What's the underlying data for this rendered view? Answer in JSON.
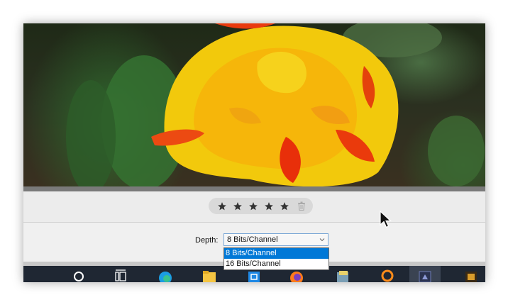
{
  "rating": {
    "stars": [
      {
        "icon": "star-icon"
      },
      {
        "icon": "star-icon"
      },
      {
        "icon": "star-icon"
      },
      {
        "icon": "star-icon"
      },
      {
        "icon": "star-icon"
      }
    ],
    "delete_icon": "trash-icon"
  },
  "depth": {
    "label": "Depth:",
    "selected": "8 Bits/Channel",
    "options": [
      "8 Bits/Channel",
      "16 Bits/Channel"
    ]
  },
  "taskbar": {
    "icons": [
      "search-icon",
      "task-view-icon",
      "edge-icon",
      "file-explorer-icon",
      "store-icon",
      "firefox-icon",
      "app-icon",
      "app-icon",
      "app-icon",
      "app-icon"
    ]
  },
  "colors": {
    "accent": "#0078d7",
    "taskbar": "#1f2733",
    "toolbar": "#ececec"
  }
}
